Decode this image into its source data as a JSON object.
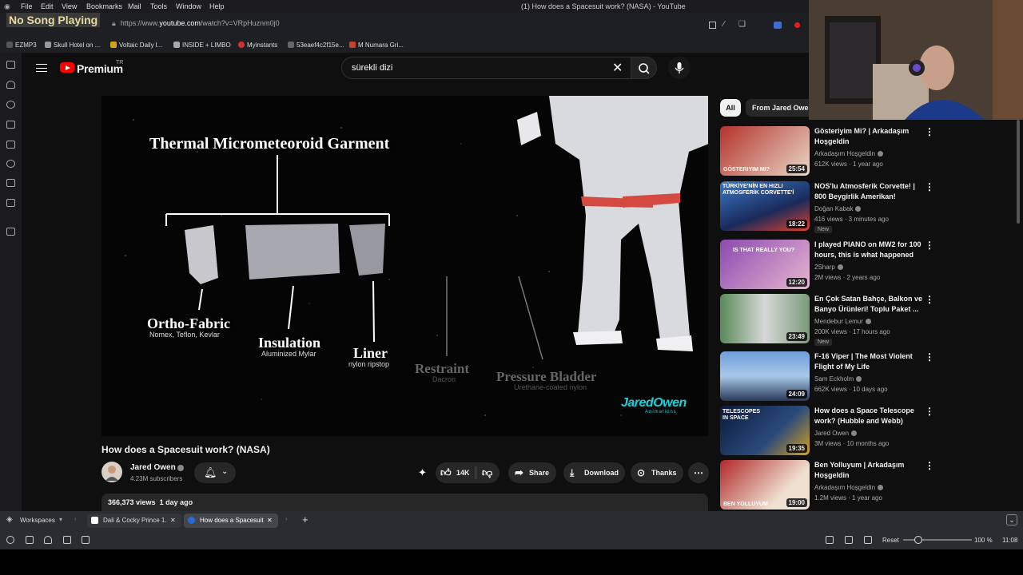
{
  "menubar": {
    "items": [
      "File",
      "Edit",
      "View",
      "Bookmarks",
      "Mail",
      "Tools",
      "Window",
      "Help"
    ],
    "window_title": "(1) How does a Spacesuit work? (NASA) - YouTube"
  },
  "overlay": {
    "now_playing": "No Song Playing"
  },
  "address": {
    "url_prefix": "https://www.",
    "url_domain": "youtube.com",
    "url_suffix": "/watch?v=VRpHuznm0j0"
  },
  "bookmarks": [
    "EZMP3",
    "Skull Hotel on ...",
    "Voltaic Daily l...",
    "INSIDE + LIMBO",
    "Myinstants",
    "53eaef4c2f15e...",
    "M Numara Gri..."
  ],
  "youtube": {
    "brand": "Premium",
    "brand_region": "TR",
    "search_value": "sürekli dizi"
  },
  "video": {
    "diagram": {
      "title": "Thermal Micrometeoroid Garment",
      "layers": [
        {
          "name": "Ortho-Fabric",
          "material": "Nomex, Teflon, Kevlar"
        },
        {
          "name": "Insulation",
          "material": "Aluminized Mylar"
        },
        {
          "name": "Liner",
          "material": "nylon ripstop"
        },
        {
          "name": "Restraint",
          "material": "Dacron"
        },
        {
          "name": "Pressure Bladder",
          "material": "Urethane-coated nylon"
        }
      ],
      "watermark_main": "JaredOwen",
      "watermark_sub": "Animations"
    },
    "title": "How does a Spacesuit work? (NASA)",
    "channel": "Jared Owen",
    "subscribers": "4.23M subscribers",
    "likes": "14K",
    "share_label": "Share",
    "download_label": "Download",
    "thanks_label": "Thanks",
    "views": "366,373 views",
    "date": "1 day ago"
  },
  "chips": [
    "All",
    "From Jared Owen"
  ],
  "related": [
    {
      "title": "Gösteriyim Mi? | Arkadaşım Hoşgeldin",
      "channel": "Arkadaşım Hoşgeldin",
      "meta": "612K views · 1 year ago",
      "duration": "25:54",
      "thumb_text": "GÖSTERIYIM MI?",
      "new": "",
      "color1": "#b5322a",
      "color2": "#e8d8c8"
    },
    {
      "title": "NOS'lu Atmosferik Corvette! | 800 Beygirlik Amerikan!",
      "channel": "Doğan Kabak",
      "meta": "416 views · 3 minutes ago",
      "duration": "18:22",
      "thumb_text": "TÜRKİYE'NİN EN HIZLI ATMOSFERİK CORVETTE'İ",
      "new": "New",
      "color1": "#3a78c9",
      "color2": "#e04030"
    },
    {
      "title": "I played PIANO on MW2 for 100 hours, this is what happened",
      "channel": "2Sharp",
      "meta": "2M views · 2 years ago",
      "duration": "12:20",
      "thumb_text": "IS THAT REALLY YOU?",
      "new": "",
      "color1": "#8a4ab0",
      "color2": "#e7b5d0"
    },
    {
      "title": "En Çok Satan Bahçe, Balkon ve Banyo Ürünleri! Toplu Paket ...",
      "channel": "Mendebur Lemur",
      "meta": "200K views · 17 hours ago",
      "duration": "23:49",
      "thumb_text": "",
      "new": "New",
      "color1": "#5a8a5a",
      "color2": "#d8d8d8"
    },
    {
      "title": "F-16 Viper | The Most Violent Flight of My Life",
      "channel": "Sam Eckholm",
      "meta": "662K views · 10 days ago",
      "duration": "24:09",
      "thumb_text": "",
      "new": "",
      "color1": "#6d9ed8",
      "color2": "#c0392b"
    },
    {
      "title": "How does a Space Telescope work? (Hubble and Webb)",
      "channel": "Jared Owen",
      "meta": "3M views · 10 months ago",
      "duration": "19:35",
      "thumb_text": "TELESCOPES IN SPACE",
      "new": "",
      "color1": "#0a1a3a",
      "color2": "#d4a020"
    },
    {
      "title": "Ben Yolluyum | Arkadaşım Hoşgeldin",
      "channel": "Arkadaşım Hoşgeldin",
      "meta": "1.2M views · 1 year ago",
      "duration": "19:00",
      "thumb_text": "BEN YOLLUYUM",
      "new": "",
      "color1": "#b02828",
      "color2": "#f0e0d0"
    }
  ],
  "tabbar": {
    "workspaces": "Workspaces",
    "tabs": [
      "Dali & Cocky Prince 1.",
      "How does a Spacesuit"
    ]
  },
  "statusbar": {
    "reset": "Reset",
    "zoom": "100 %",
    "clock": "11:08"
  },
  "colors": {
    "yt_red": "#ff0000",
    "bg": "#0f0f0f",
    "chip_bg": "#272727",
    "watermark": "#1fd0d8"
  }
}
